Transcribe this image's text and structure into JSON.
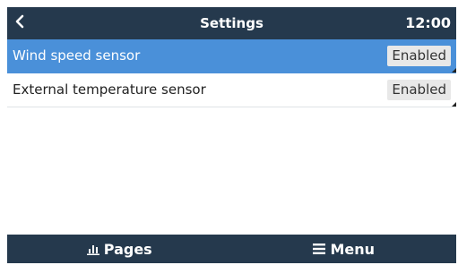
{
  "header": {
    "back_icon": "chevron-left-icon",
    "title": "Settings",
    "time": "12:00"
  },
  "items": [
    {
      "label": "Wind speed sensor",
      "value": "Enabled",
      "selected": true
    },
    {
      "label": "External temperature sensor",
      "value": "Enabled",
      "selected": false
    }
  ],
  "footer": {
    "pages_icon": "bar-chart-icon",
    "pages_label": "Pages",
    "menu_icon": "hamburger-menu-icon",
    "menu_label": "Menu"
  },
  "colors": {
    "header_bg": "#25394d",
    "selection": "#4a90d9",
    "value_bg": "#e8e8e8"
  }
}
